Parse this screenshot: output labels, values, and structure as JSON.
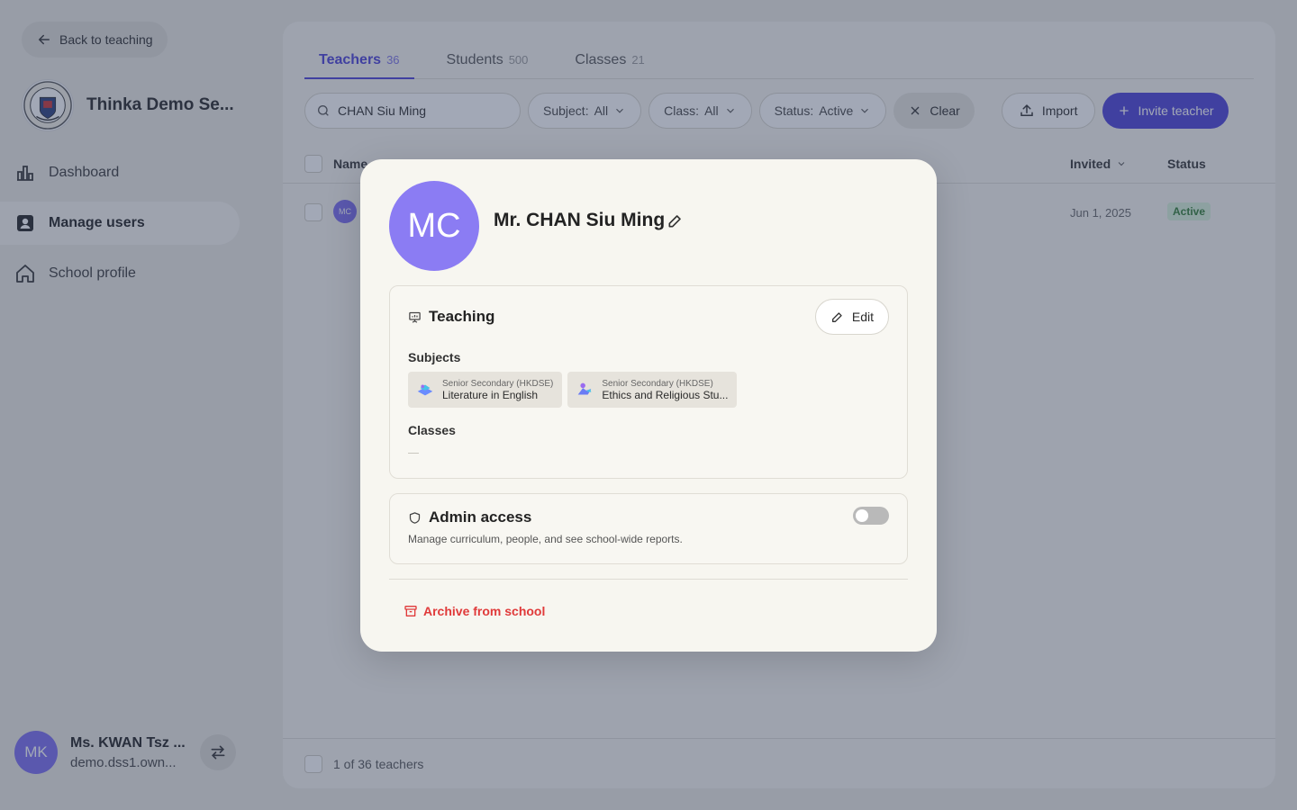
{
  "sidebar": {
    "back_label": "Back to teaching",
    "school_name": "Thinka Demo Se...",
    "nav": [
      {
        "label": "Dashboard",
        "icon": "bar-chart-icon"
      },
      {
        "label": "Manage users",
        "icon": "user-card-icon"
      },
      {
        "label": "School profile",
        "icon": "home-icon"
      }
    ],
    "active_nav": "Manage users",
    "user": {
      "initials": "MK",
      "name": "Ms. KWAN Tsz ...",
      "email": "demo.dss1.own..."
    }
  },
  "main": {
    "tabs": [
      {
        "label": "Teachers",
        "count": "36"
      },
      {
        "label": "Students",
        "count": "500"
      },
      {
        "label": "Classes",
        "count": "21"
      }
    ],
    "active_tab": "Teachers",
    "search_value": "CHAN Siu Ming",
    "filters": [
      {
        "label": "Subject:",
        "value": "All"
      },
      {
        "label": "Class:",
        "value": "All"
      },
      {
        "label": "Status:",
        "value": "Active"
      }
    ],
    "clear_label": "Clear",
    "import_label": "Import",
    "invite_label": "Invite teacher",
    "columns": {
      "name": "Name",
      "invited": "Invited",
      "status": "Status"
    },
    "row": {
      "initials": "MC",
      "invited": "Jun 1, 2025",
      "status": "Active"
    },
    "footer": "1 of 36 teachers"
  },
  "modal": {
    "initials": "MC",
    "name": "Mr. CHAN Siu Ming",
    "teaching": {
      "title": "Teaching",
      "edit_label": "Edit",
      "subjects_label": "Subjects",
      "subjects": [
        {
          "level": "Senior Secondary (HKDSE)",
          "name": "Literature in English"
        },
        {
          "level": "Senior Secondary (HKDSE)",
          "name": "Ethics and Religious Stu..."
        }
      ],
      "classes_label": "Classes"
    },
    "admin": {
      "title": "Admin access",
      "description": "Manage curriculum, people, and see school-wide reports.",
      "enabled": false
    },
    "archive_label": "Archive from school",
    "colors": {
      "accent": "#4b3fd6",
      "avatar": "#8b7cf3",
      "danger": "#e03a3a"
    }
  }
}
